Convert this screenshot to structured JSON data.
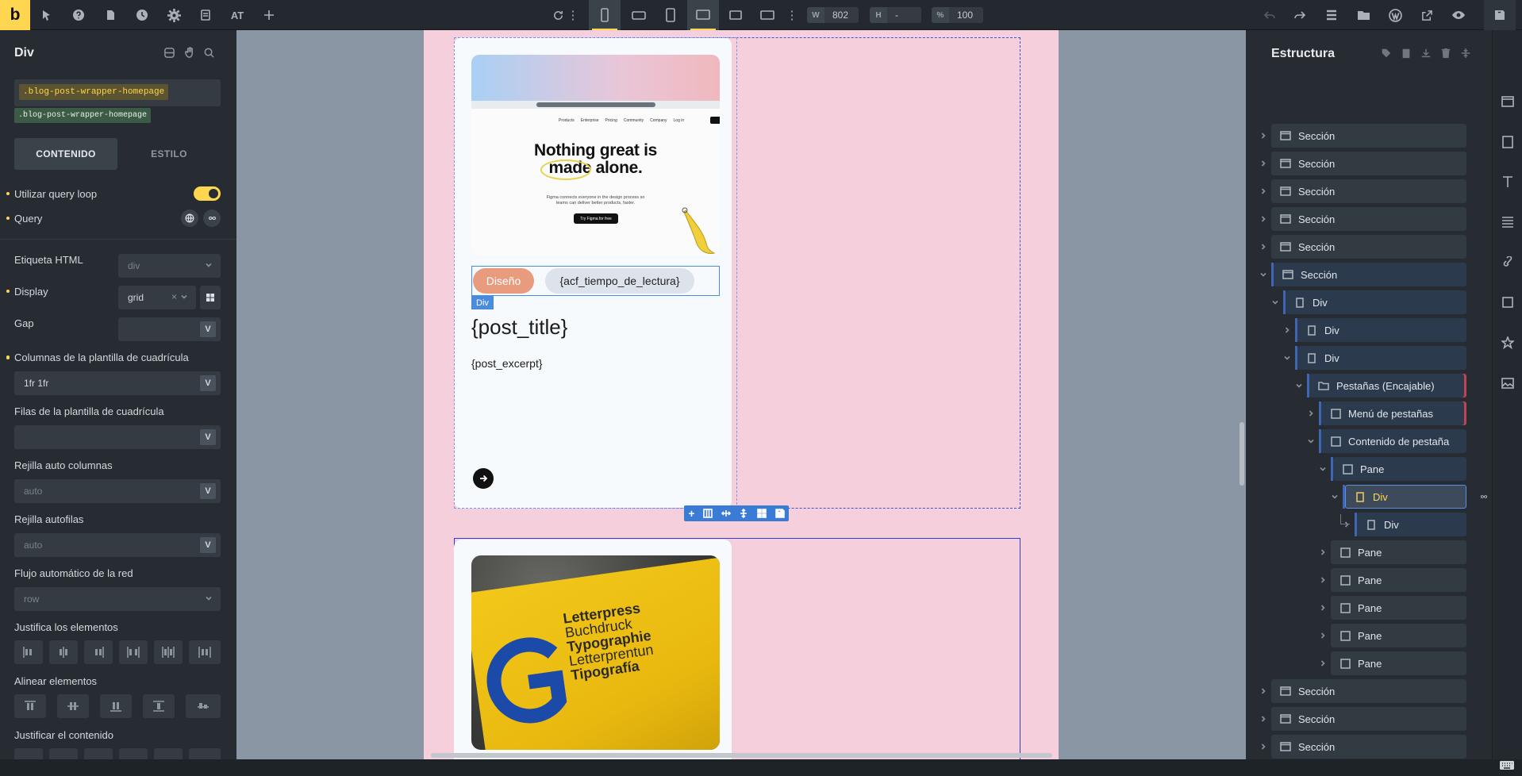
{
  "toolbar": {
    "logo": "b",
    "at_label": "AT",
    "width_label": "W",
    "width_value": "802",
    "height_label": "H",
    "height_value": "-",
    "zoom_label": "%",
    "zoom_value": "100"
  },
  "left_panel": {
    "title": "Div",
    "class_selected": ".blog-post-wrapper-homepage",
    "class_chip": ".blog-post-wrapper-homepage",
    "tabs": [
      "CONTENIDO",
      "ESTILO"
    ],
    "query_loop_label": "Utilizar query loop",
    "query_label": "Query",
    "html_tag_label": "Etiqueta HTML",
    "html_tag_value": "div",
    "display_label": "Display",
    "display_value": "grid",
    "gap_label": "Gap",
    "grid_cols_label": "Columnas de la plantilla de cuadrícula",
    "grid_cols_value": "1fr 1fr",
    "grid_rows_label": "Filas de la plantilla de cuadrícula",
    "auto_cols_label": "Rejilla auto columnas",
    "auto_cols_placeholder": "auto",
    "auto_rows_label": "Rejilla autofilas",
    "auto_rows_placeholder": "auto",
    "auto_flow_label": "Flujo automático de la red",
    "auto_flow_value": "row",
    "justify_items_label": "Justifica los elementos",
    "align_items_label": "Alinear elementos",
    "justify_content_label": "Justificar el contenido",
    "unit_button": "V"
  },
  "canvas": {
    "hero_heading_line1": "Nothing great is",
    "hero_heading_line2": "made alone.",
    "hero_sub": "Figma connects everyone in the design process so teams can deliver better products, faster.",
    "hero_cta": "Try Figma for free",
    "hero_nav": [
      "Products",
      "Enterprise",
      "Pricing",
      "Community",
      "Company",
      "Log in"
    ],
    "category_pill": "Diseño",
    "reading_time_pill": "{acf_tiempo_de_lectura}",
    "div_badge": "Div",
    "post_title": "{post_title}",
    "post_excerpt": "{post_excerpt}",
    "poster_lines": [
      "Letterpress",
      "Buchdruck",
      "Typographie",
      "Letterprentun",
      "Tipografía"
    ]
  },
  "structure": {
    "title": "Estructura",
    "items": [
      {
        "label": "Sección"
      },
      {
        "label": "Sección"
      },
      {
        "label": "Sección"
      },
      {
        "label": "Sección"
      },
      {
        "label": "Sección"
      },
      {
        "label": "Sección"
      },
      {
        "label": "Div"
      },
      {
        "label": "Div"
      },
      {
        "label": "Div"
      },
      {
        "label": "Pestañas (Encajable)"
      },
      {
        "label": "Menú de pestañas"
      },
      {
        "label": "Contenido de pestaña"
      },
      {
        "label": "Pane"
      },
      {
        "label": "Div"
      },
      {
        "label": "Div"
      },
      {
        "label": "Pane"
      },
      {
        "label": "Pane"
      },
      {
        "label": "Pane"
      },
      {
        "label": "Pane"
      },
      {
        "label": "Pane"
      },
      {
        "label": "Sección"
      },
      {
        "label": "Sección"
      },
      {
        "label": "Sección"
      }
    ]
  },
  "colors": {
    "accent": "#ffd64f",
    "selection": "#3a55d8",
    "page_bg": "#f5cfdc",
    "panel_bg": "#262c32"
  }
}
